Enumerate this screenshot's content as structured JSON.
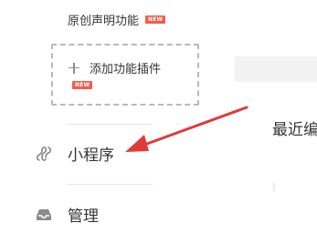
{
  "sidebar": {
    "feature": {
      "label": "原创声明功能",
      "badge": "NEW"
    },
    "add_plugin": {
      "label": "添加功能插件",
      "badge": "NEW"
    },
    "nav": [
      {
        "label": "小程序",
        "icon": "link-icon"
      },
      {
        "label": "管理",
        "icon": "inbox-icon"
      }
    ]
  },
  "main": {
    "section_title": "最近编"
  },
  "annotation": {
    "type": "red-arrow",
    "points_to": "小程序",
    "color": "#e03a3a"
  }
}
